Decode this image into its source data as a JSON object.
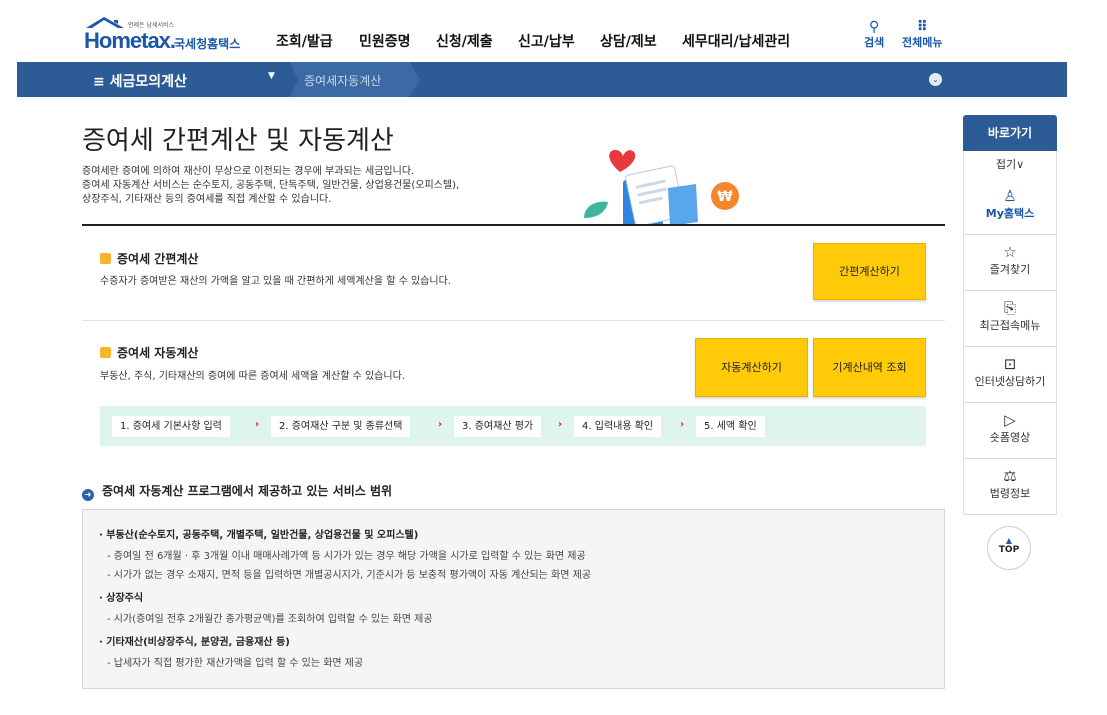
{
  "header": {
    "logo_small": "언제든 납세서비스",
    "logo_main": "Hometax.",
    "logo_kr": "국세청홈택스",
    "nav": [
      "조회/발급",
      "민원증명",
      "신청/제출",
      "신고/납부",
      "상담/제보",
      "세무대리/납세관리"
    ],
    "search_label": "검색",
    "all_menu_label": "전체메뉴"
  },
  "bar": {
    "menu_label": "≡  세금모의계산",
    "crumb": "증여세자동계산"
  },
  "page": {
    "title": "증여세 간편계산 및 자동계산",
    "desc": [
      "증여세란 증여에 의하여 재산이 무상으로 이전되는 경우에 부과되는 세금입니다.",
      "증여세 자동계산 서비스는 순수토지, 공동주택, 단독주택, 일반건물, 상업용건물(오피스텔),",
      "상장주식, 기타재산 등의 증여세를 직접 계산할 수 있습니다."
    ]
  },
  "simple": {
    "heading": "증여세 간편계산",
    "text": "수증자가 증여받은 재산의 가액을 알고 있을 때 간편하게 세액계산을 할 수 있습니다.",
    "button": "간편계산하기"
  },
  "auto": {
    "heading": "증여세 자동계산",
    "text": "부동산, 주식, 기타재산의 증여에 따른 증여세 세액을 계산할 수 있습니다.",
    "button": "자동계산하기",
    "history_button": "기계산내역 조회",
    "steps": [
      "1. 증여세 기본사항 입력",
      "2. 증여재산 구분 및 종류선택",
      "3. 증여재산 평가",
      "4. 입력내용 확인",
      "5. 세액 확인"
    ]
  },
  "services": {
    "heading": "증여세 자동계산 프로그램에서 제공하고 있는 서비스 범위",
    "lines": [
      "· 부동산(순수토지, 공동주택, 개별주택, 일반건물, 상업용건물 및 오피스텔)",
      "- 증여일 전 6개월 · 후 3개월 이내 매매사례가액 등 시가가 있는 경우 해당 가액을 시가로 입력할 수 있는 화면 제공",
      "- 시가가 없는 경우 소재지, 면적 등을 입력하면 개별공시지가, 기준시가 등 보충적 평가액이 자동 계산되는 화면 제공",
      "· 상장주식",
      "- 시가(증여일 전후 2개월간 종가평균액)를 조회하여 입력할 수 있는 화면 제공",
      "· 기타재산(비상장주식, 분양권, 금융재산 등)",
      "- 납세자가 직접 평가한 재산가액을 입력 할 수 있는 화면 제공"
    ]
  },
  "side": {
    "head": "바로가기",
    "fold": "접기∨",
    "items": [
      "My홈택스",
      "즐겨찾기",
      "최근접속메뉴",
      "인터넷상담하기",
      "숏폼영상",
      "법령정보"
    ],
    "top": "TOP"
  }
}
